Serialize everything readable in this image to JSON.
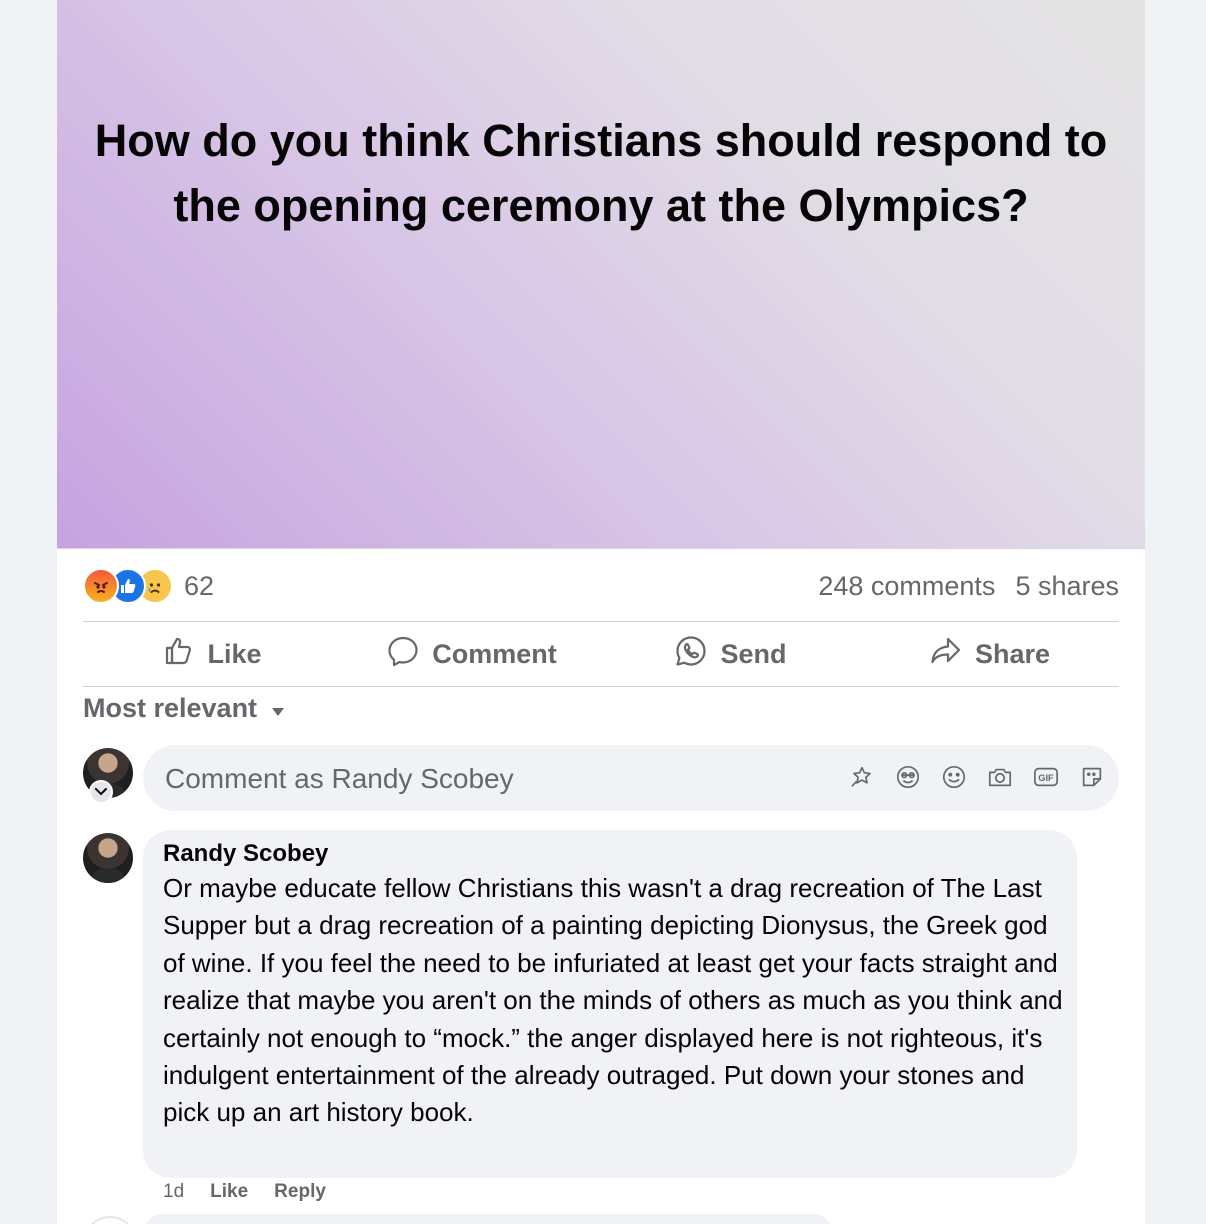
{
  "post": {
    "question": "How do you think Christians should respond to the opening ceremony at the Olympics?",
    "banner_gradient": [
      "#c6a3e0",
      "#e4e4e4"
    ]
  },
  "stats": {
    "reactions": [
      "angry-reaction-icon",
      "like-reaction-icon",
      "sad-reaction-icon"
    ],
    "reaction_count": "62",
    "comments": "248 comments",
    "shares": "5 shares"
  },
  "actions": {
    "like": "Like",
    "comment": "Comment",
    "send": "Send",
    "share": "Share"
  },
  "sort": {
    "label": "Most relevant"
  },
  "composer": {
    "placeholder": "Comment as Randy Scobey",
    "icons": [
      "avatar-sticker-icon",
      "emoji-face-icon",
      "smiley-icon",
      "camera-icon",
      "gif-icon",
      "sticker-icon"
    ]
  },
  "comment": {
    "author": "Randy Scobey",
    "text": "Or maybe educate fellow Christians this wasn't a drag recreation of The Last Supper but a drag recreation of a painting depicting Dionysus, the Greek god of wine. If you feel the need to be infuriated at least get your facts straight and realize that maybe you aren't on the minds of others as much as you think and certainly not enough to “mock.” the anger displayed here is not righteous, it's indulgent entertainment of the already outraged. Put down your stones and pick up an art history book.",
    "age": "1d",
    "like": "Like",
    "reply": "Reply"
  },
  "colors": {
    "like_blue": "#1b74e4",
    "muted_text": "#65676b",
    "bubble_bg": "#f0f2f5"
  }
}
